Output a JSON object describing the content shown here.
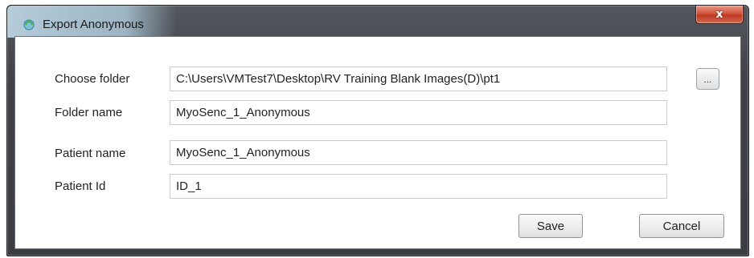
{
  "window": {
    "title": "Export Anonymous",
    "close_label": "x"
  },
  "form": {
    "fields": [
      {
        "label": "Choose folder",
        "value": "C:\\Users\\VMTest7\\Desktop\\RV Training Blank Images(D)\\pt1"
      },
      {
        "label": "Folder name",
        "value": "MyoSenc_1_Anonymous"
      },
      {
        "label": "Patient name",
        "value": "MyoSenc_1_Anonymous"
      },
      {
        "label": "Patient Id",
        "value": "ID_1"
      }
    ],
    "browse_label": "..."
  },
  "buttons": {
    "save": "Save",
    "cancel": "Cancel"
  }
}
